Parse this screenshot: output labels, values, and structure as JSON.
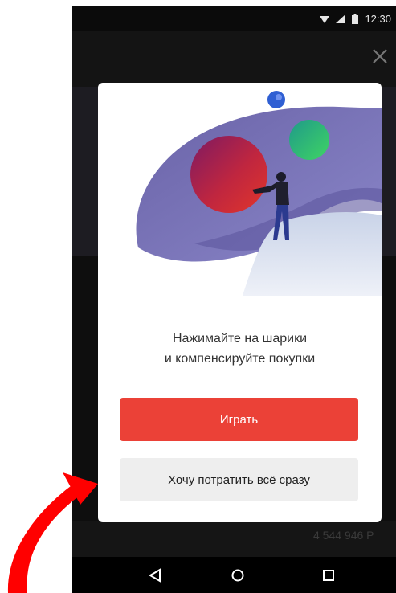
{
  "status_bar": {
    "time": "12:30"
  },
  "dialog": {
    "message_line1": "Нажимайте на шарики",
    "message_line2": "и компенсируйте покупки",
    "primary_button": "Играть",
    "secondary_button": "Хочу потратить всё сразу"
  },
  "background": {
    "partial_text": "4 544 946 P"
  },
  "colors": {
    "primary": "#eb4137",
    "secondary_bg": "#eeeeee",
    "annotation_arrow": "#ff0000",
    "illustration_blob": "#7b77b8",
    "ball_red": "#b4214f",
    "ball_green": "#2fbf7a",
    "ball_blue": "#2c5fd1"
  },
  "icons": [
    "wifi-icon",
    "signal-icon",
    "battery-icon",
    "close-icon",
    "back-icon",
    "home-icon",
    "recents-icon"
  ]
}
